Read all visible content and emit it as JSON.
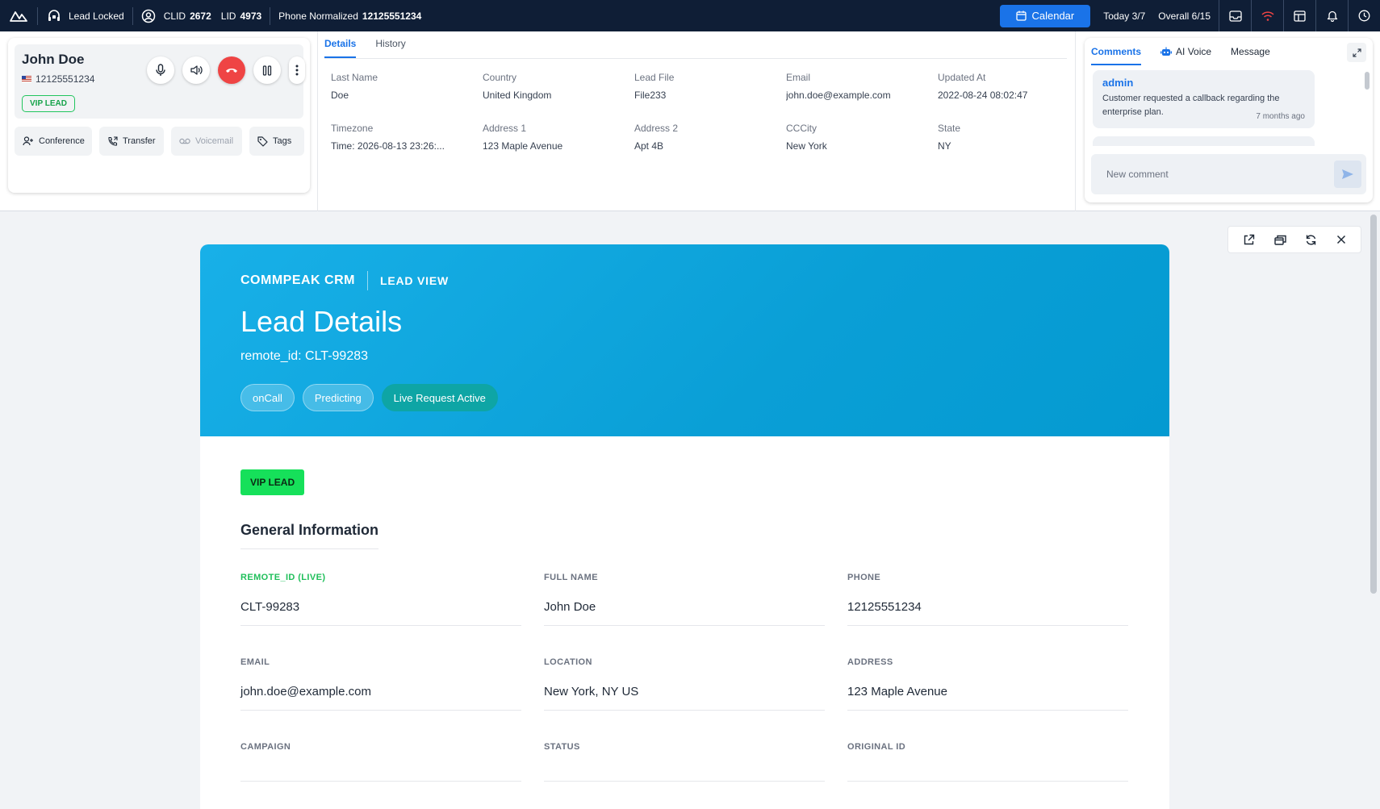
{
  "topbar": {
    "lead_locked": "Lead Locked",
    "clid_label": "CLID",
    "clid_value": "2672",
    "lid_label": "LID",
    "lid_value": "4973",
    "phone_label": "Phone Normalized",
    "phone_value": "12125551234",
    "calendar_label": "Calendar",
    "today_label": "Today 3/7",
    "overall_label": "Overall 6/15"
  },
  "call": {
    "name": "John Doe",
    "phone": "12125551234",
    "vip_label": "VIP LEAD",
    "actions": {
      "conference": "Conference",
      "transfer": "Transfer",
      "voicemail": "Voicemail",
      "tags": "Tags"
    }
  },
  "details": {
    "tabs": [
      "Details",
      "History"
    ],
    "fields": [
      {
        "label": "Last Name",
        "value": "Doe"
      },
      {
        "label": "Country",
        "value": "United Kingdom"
      },
      {
        "label": "Lead File",
        "value": "File233"
      },
      {
        "label": "Email",
        "value": "john.doe@example.com"
      },
      {
        "label": "Updated At",
        "value": "2022-08-24 08:02:47"
      },
      {
        "label": "Timezone",
        "value": "Time: 2026-08-13 23:26:..."
      },
      {
        "label": "Address 1",
        "value": "123 Maple Avenue"
      },
      {
        "label": "Address 2",
        "value": "Apt 4B"
      },
      {
        "label": "CCCity",
        "value": "New York"
      },
      {
        "label": "State",
        "value": "NY"
      }
    ]
  },
  "comments": {
    "tabs": [
      "Comments",
      "AI Voice",
      "Message"
    ],
    "items": [
      {
        "author": "admin",
        "text": "Customer requested a callback regarding the enterprise plan.",
        "time": "7 months ago"
      }
    ],
    "input_placeholder": "New comment"
  },
  "lead_page": {
    "brand": "COMMPEAK CRM",
    "section": "LEAD VIEW",
    "title": "Lead Details",
    "subtitle": "remote_id: CLT-99283",
    "pills": [
      "onCall",
      "Predicting",
      "Live Request Active"
    ],
    "vip_badge": "VIP LEAD",
    "general_title": "General Information",
    "fields": [
      {
        "label": "REMOTE_ID (LIVE)",
        "value": "CLT-99283"
      },
      {
        "label": "FULL NAME",
        "value": "John Doe"
      },
      {
        "label": "PHONE",
        "value": "12125551234"
      },
      {
        "label": "EMAIL",
        "value": "john.doe@example.com"
      },
      {
        "label": "LOCATION",
        "value": "New York, NY US"
      },
      {
        "label": "ADDRESS",
        "value": "123 Maple Avenue"
      },
      {
        "label": "CAMPAIGN",
        "value": ""
      },
      {
        "label": "STATUS",
        "value": ""
      },
      {
        "label": "ORIGINAL ID",
        "value": ""
      }
    ]
  },
  "colors": {
    "topbar_bg": "#0f1e36",
    "accent_blue": "#1a73e8",
    "hangup_red": "#ef4444",
    "vip_green": "#16e05a",
    "hero_blue": "#0a9fd6"
  }
}
